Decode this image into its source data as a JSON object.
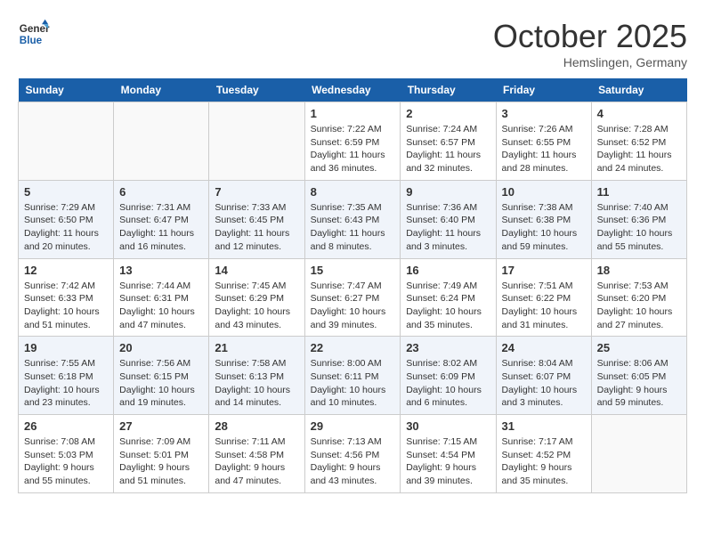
{
  "header": {
    "logo_line1": "General",
    "logo_line2": "Blue",
    "month": "October 2025",
    "location": "Hemslingen, Germany"
  },
  "weekdays": [
    "Sunday",
    "Monday",
    "Tuesday",
    "Wednesday",
    "Thursday",
    "Friday",
    "Saturday"
  ],
  "weeks": [
    [
      {
        "day": "",
        "info": ""
      },
      {
        "day": "",
        "info": ""
      },
      {
        "day": "",
        "info": ""
      },
      {
        "day": "1",
        "info": "Sunrise: 7:22 AM\nSunset: 6:59 PM\nDaylight: 11 hours\nand 36 minutes."
      },
      {
        "day": "2",
        "info": "Sunrise: 7:24 AM\nSunset: 6:57 PM\nDaylight: 11 hours\nand 32 minutes."
      },
      {
        "day": "3",
        "info": "Sunrise: 7:26 AM\nSunset: 6:55 PM\nDaylight: 11 hours\nand 28 minutes."
      },
      {
        "day": "4",
        "info": "Sunrise: 7:28 AM\nSunset: 6:52 PM\nDaylight: 11 hours\nand 24 minutes."
      }
    ],
    [
      {
        "day": "5",
        "info": "Sunrise: 7:29 AM\nSunset: 6:50 PM\nDaylight: 11 hours\nand 20 minutes."
      },
      {
        "day": "6",
        "info": "Sunrise: 7:31 AM\nSunset: 6:47 PM\nDaylight: 11 hours\nand 16 minutes."
      },
      {
        "day": "7",
        "info": "Sunrise: 7:33 AM\nSunset: 6:45 PM\nDaylight: 11 hours\nand 12 minutes."
      },
      {
        "day": "8",
        "info": "Sunrise: 7:35 AM\nSunset: 6:43 PM\nDaylight: 11 hours\nand 8 minutes."
      },
      {
        "day": "9",
        "info": "Sunrise: 7:36 AM\nSunset: 6:40 PM\nDaylight: 11 hours\nand 3 minutes."
      },
      {
        "day": "10",
        "info": "Sunrise: 7:38 AM\nSunset: 6:38 PM\nDaylight: 10 hours\nand 59 minutes."
      },
      {
        "day": "11",
        "info": "Sunrise: 7:40 AM\nSunset: 6:36 PM\nDaylight: 10 hours\nand 55 minutes."
      }
    ],
    [
      {
        "day": "12",
        "info": "Sunrise: 7:42 AM\nSunset: 6:33 PM\nDaylight: 10 hours\nand 51 minutes."
      },
      {
        "day": "13",
        "info": "Sunrise: 7:44 AM\nSunset: 6:31 PM\nDaylight: 10 hours\nand 47 minutes."
      },
      {
        "day": "14",
        "info": "Sunrise: 7:45 AM\nSunset: 6:29 PM\nDaylight: 10 hours\nand 43 minutes."
      },
      {
        "day": "15",
        "info": "Sunrise: 7:47 AM\nSunset: 6:27 PM\nDaylight: 10 hours\nand 39 minutes."
      },
      {
        "day": "16",
        "info": "Sunrise: 7:49 AM\nSunset: 6:24 PM\nDaylight: 10 hours\nand 35 minutes."
      },
      {
        "day": "17",
        "info": "Sunrise: 7:51 AM\nSunset: 6:22 PM\nDaylight: 10 hours\nand 31 minutes."
      },
      {
        "day": "18",
        "info": "Sunrise: 7:53 AM\nSunset: 6:20 PM\nDaylight: 10 hours\nand 27 minutes."
      }
    ],
    [
      {
        "day": "19",
        "info": "Sunrise: 7:55 AM\nSunset: 6:18 PM\nDaylight: 10 hours\nand 23 minutes."
      },
      {
        "day": "20",
        "info": "Sunrise: 7:56 AM\nSunset: 6:15 PM\nDaylight: 10 hours\nand 19 minutes."
      },
      {
        "day": "21",
        "info": "Sunrise: 7:58 AM\nSunset: 6:13 PM\nDaylight: 10 hours\nand 14 minutes."
      },
      {
        "day": "22",
        "info": "Sunrise: 8:00 AM\nSunset: 6:11 PM\nDaylight: 10 hours\nand 10 minutes."
      },
      {
        "day": "23",
        "info": "Sunrise: 8:02 AM\nSunset: 6:09 PM\nDaylight: 10 hours\nand 6 minutes."
      },
      {
        "day": "24",
        "info": "Sunrise: 8:04 AM\nSunset: 6:07 PM\nDaylight: 10 hours\nand 3 minutes."
      },
      {
        "day": "25",
        "info": "Sunrise: 8:06 AM\nSunset: 6:05 PM\nDaylight: 9 hours\nand 59 minutes."
      }
    ],
    [
      {
        "day": "26",
        "info": "Sunrise: 7:08 AM\nSunset: 5:03 PM\nDaylight: 9 hours\nand 55 minutes."
      },
      {
        "day": "27",
        "info": "Sunrise: 7:09 AM\nSunset: 5:01 PM\nDaylight: 9 hours\nand 51 minutes."
      },
      {
        "day": "28",
        "info": "Sunrise: 7:11 AM\nSunset: 4:58 PM\nDaylight: 9 hours\nand 47 minutes."
      },
      {
        "day": "29",
        "info": "Sunrise: 7:13 AM\nSunset: 4:56 PM\nDaylight: 9 hours\nand 43 minutes."
      },
      {
        "day": "30",
        "info": "Sunrise: 7:15 AM\nSunset: 4:54 PM\nDaylight: 9 hours\nand 39 minutes."
      },
      {
        "day": "31",
        "info": "Sunrise: 7:17 AM\nSunset: 4:52 PM\nDaylight: 9 hours\nand 35 minutes."
      },
      {
        "day": "",
        "info": ""
      }
    ]
  ]
}
